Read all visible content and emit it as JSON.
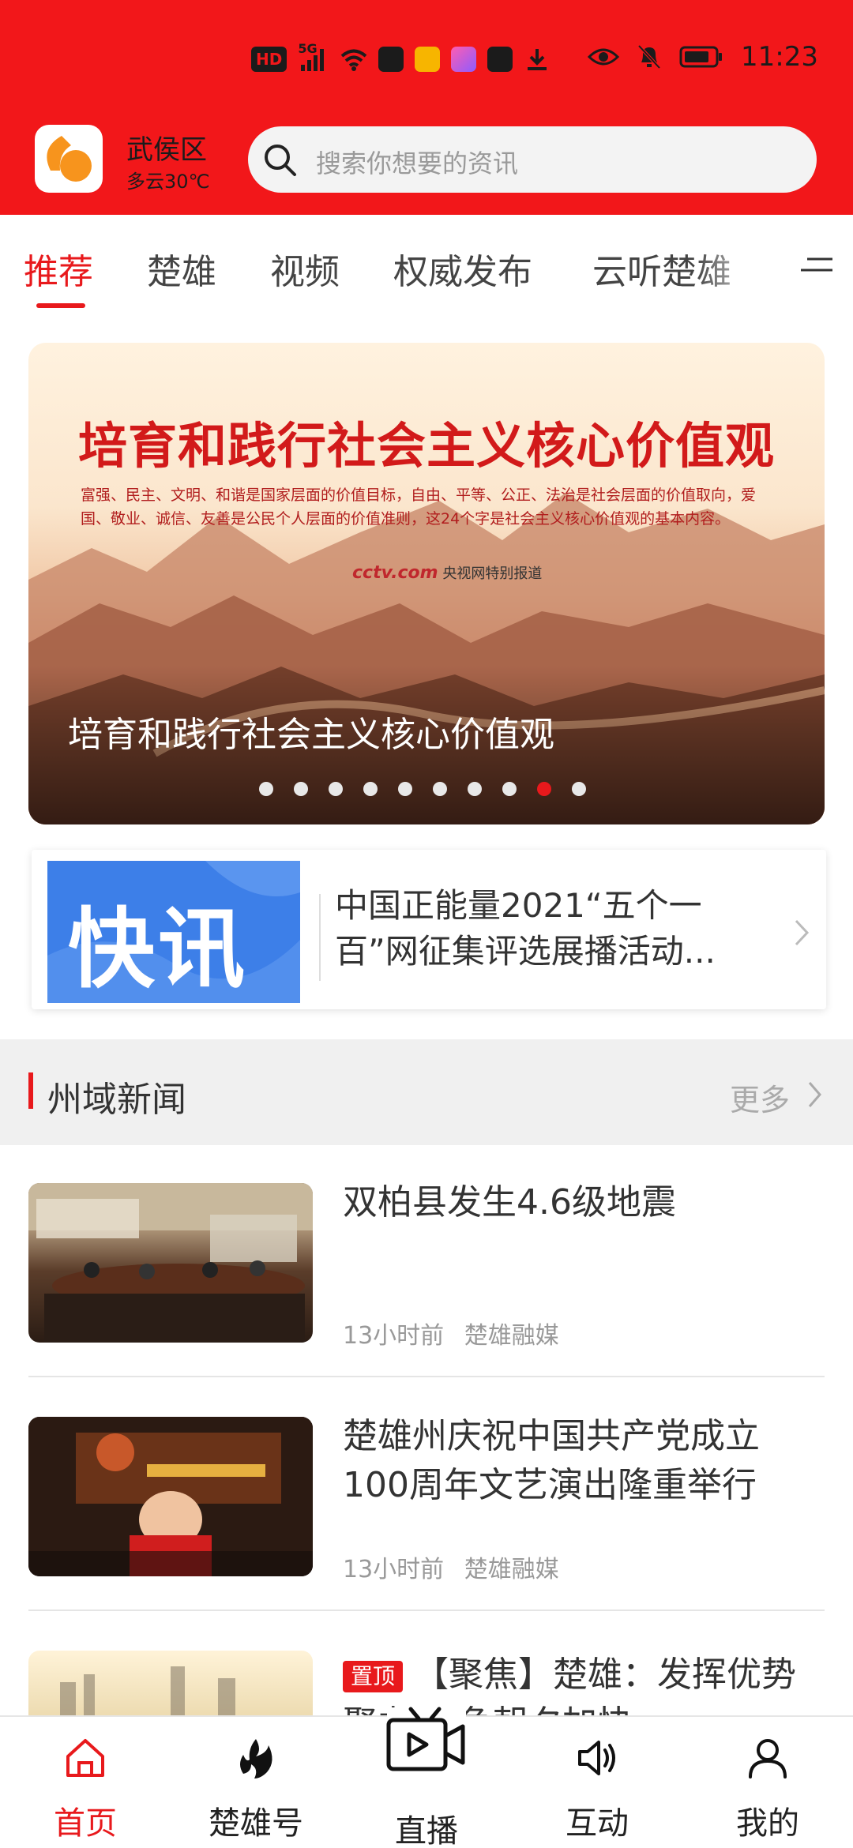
{
  "status_bar": {
    "time": "11:23",
    "hd_badge": "HD",
    "network_label": "5G",
    "icons": [
      "hd-icon",
      "signal-icon",
      "wifi-icon",
      "mail-icon",
      "app-notification-icon",
      "app-notification-icon",
      "app-notification-icon",
      "download-icon",
      "eye-icon",
      "bell-off-icon",
      "battery-icon"
    ],
    "colors": {
      "text": "#1b1b1b"
    }
  },
  "header": {
    "location": "武侯区",
    "weather": "多云30℃",
    "search_placeholder": "搜索你想要的资讯",
    "colors": {
      "background": "#f2171a",
      "search_bg": "#f3f3f3",
      "logo_orange": "#f7941d"
    }
  },
  "tabs": {
    "items": [
      {
        "label": "推荐",
        "active": true
      },
      {
        "label": "楚雄",
        "active": false
      },
      {
        "label": "视频",
        "active": false
      },
      {
        "label": "权威发布",
        "active": false
      },
      {
        "label": "云听楚雄",
        "active": false
      }
    ],
    "menu_icon": "menu-icon",
    "colors": {
      "active": "#e8191c",
      "inactive": "#444444"
    }
  },
  "banner": {
    "image_headline": "培育和践行社会主义核心价值观",
    "image_subtext": "富强、民主、文明、和谐是国家层面的价值目标，自由、平等、公正、法治是社会层面的价值取向，爱国、敬业、诚信、友善是公民个人层面的价值准则，这24个字是社会主义核心价值观的基本内容。",
    "image_source_logo": "cctv.com",
    "image_source_text": "央视网特别报道",
    "caption": "培育和践行社会主义核心价值观",
    "slide_count": 10,
    "active_slide": 9
  },
  "flash_news": {
    "image_label": "快讯",
    "title": "中国正能量2021“五个一百”网征集评选展播活动...",
    "chevron_icon": "chevron-right-icon"
  },
  "section": {
    "title": "州域新闻",
    "more_label": "更多"
  },
  "news": [
    {
      "title": "双柏县发生4.6级地震",
      "time": "13小时前",
      "source": "楚雄融媒",
      "pinned": false
    },
    {
      "title": "楚雄州庆祝中国共产党成立100周年文艺演出隆重举行",
      "time": "13小时前",
      "source": "楚雄融媒",
      "pinned": false
    },
    {
      "title": "【聚焦】楚雄：发挥优势 聚力 只争朝夕加快",
      "badge": "置顶",
      "pinned": true
    }
  ],
  "bottom_nav": {
    "items": [
      {
        "label": "首页",
        "icon": "home-icon",
        "active": true
      },
      {
        "label": "楚雄号",
        "icon": "flame-icon",
        "active": false
      },
      {
        "label": "直播",
        "icon": "live-tv-icon",
        "active": false
      },
      {
        "label": "互动",
        "icon": "speaker-icon",
        "active": false
      },
      {
        "label": "我的",
        "icon": "user-icon",
        "active": false
      }
    ]
  }
}
